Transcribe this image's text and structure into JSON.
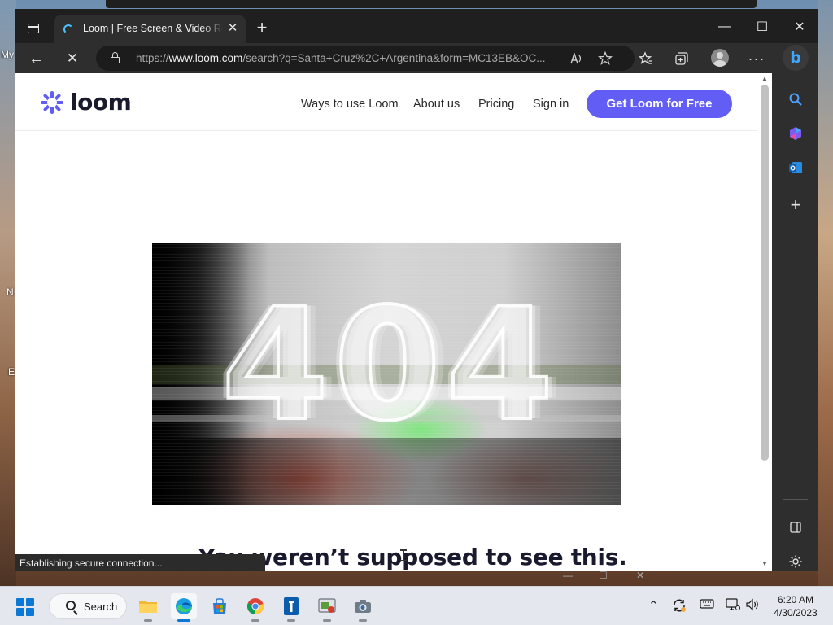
{
  "desktop": {
    "labels": [
      "My",
      "N",
      "E"
    ]
  },
  "browser": {
    "tab": {
      "title": "Loom | Free Screen & Video Recording Software",
      "close": "✕"
    },
    "new_tab": "+",
    "window_controls": {
      "minimize": "—",
      "maximize": "☐",
      "close": "✕"
    },
    "nav": {
      "back": "←",
      "stop": "✕"
    },
    "address": {
      "scheme": "https://",
      "host": "www.loom.com",
      "path": "/search?q=Santa+Cruz%2C+Argentina&form=MC13EB&OC..."
    },
    "status_text": "Establishing secure connection..."
  },
  "page": {
    "logo_text": "loom",
    "nav_links": [
      "Ways to use Loom",
      "About us",
      "Pricing",
      "Sign in"
    ],
    "cta_label": "Get Loom for Free",
    "hero_text": "404",
    "headline": "You weren’t supposed to see this."
  },
  "taskbar": {
    "search_label": "Search",
    "clock": {
      "time": "6:20 AM",
      "date": "4/30/2023"
    }
  },
  "colors": {
    "brand": "#625df5",
    "edge_accent": "#0a78d4",
    "chrome_dark": "#1f1f1f"
  }
}
